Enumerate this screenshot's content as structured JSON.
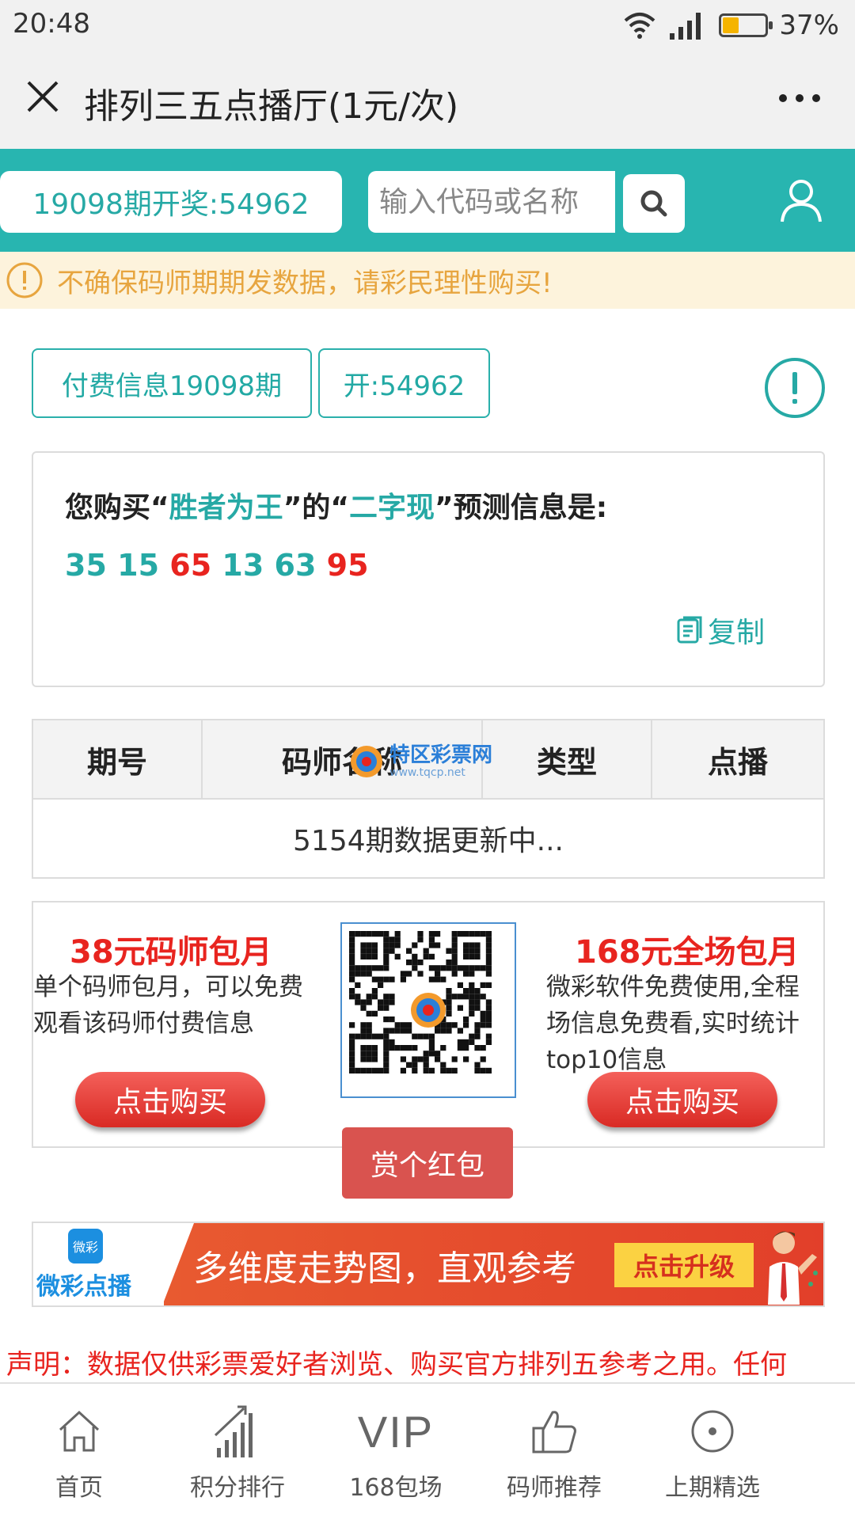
{
  "status_bar": {
    "time": "20:48",
    "battery_text": "37%",
    "battery_level": 0.37
  },
  "header": {
    "title": "排列三五点播厅(1元/次)"
  },
  "search": {
    "draw_result": "19098期开奖:54962",
    "placeholder": "输入代码或名称"
  },
  "notice": {
    "text": "不确保码师期期发数据，请彩民理性购买!"
  },
  "paid": {
    "info_label": "付费信息19098期",
    "open_label": "开:54962"
  },
  "prediction": {
    "prefix": "您购买“",
    "master": "胜者为王",
    "mid": "”的“",
    "type": "二字现",
    "suffix": "”预测信息是:",
    "numbers": [
      {
        "value": "35",
        "color": "#26a9a5"
      },
      {
        "value": "15",
        "color": "#26a9a5"
      },
      {
        "value": "65",
        "color": "#e8241f"
      },
      {
        "value": "13",
        "color": "#26a9a5"
      },
      {
        "value": "63",
        "color": "#26a9a5"
      },
      {
        "value": "95",
        "color": "#e8241f"
      }
    ],
    "copy_label": "复制"
  },
  "table": {
    "headers": [
      "期号",
      "码师名称",
      "类型",
      "点播"
    ],
    "message": "5154期数据更新中..."
  },
  "watermark": {
    "text": "特区彩票网",
    "url": "www.tqcp.net"
  },
  "promo": {
    "left": {
      "title": "38元码师包月",
      "desc": "单个码师包月，可以免费观看该码师付费信息",
      "button": "点击购买"
    },
    "right": {
      "title": "168元全场包月",
      "desc": "微彩软件免费使用,全程场信息免费看,实时统计top10信息",
      "button": "点击购买"
    },
    "red_packet": "赏个红包"
  },
  "banner": {
    "logo_icon": "微彩",
    "logo_text": "微彩点播",
    "text": "多维度走势图，直观参考",
    "button": "点击升级"
  },
  "disclaimer": "声明：数据仅供彩票爱好者浏览、购买官方排列五参考之用。任何",
  "nav": [
    {
      "label": "首页",
      "icon": "home-icon"
    },
    {
      "label": "积分排行",
      "icon": "bar-chart-icon"
    },
    {
      "label": "168包场",
      "icon": "vip-icon",
      "icon_text": "VIP"
    },
    {
      "label": "码师推荐",
      "icon": "thumbs-up-icon"
    },
    {
      "label": "上期精选",
      "icon": "target-circle-icon"
    }
  ]
}
